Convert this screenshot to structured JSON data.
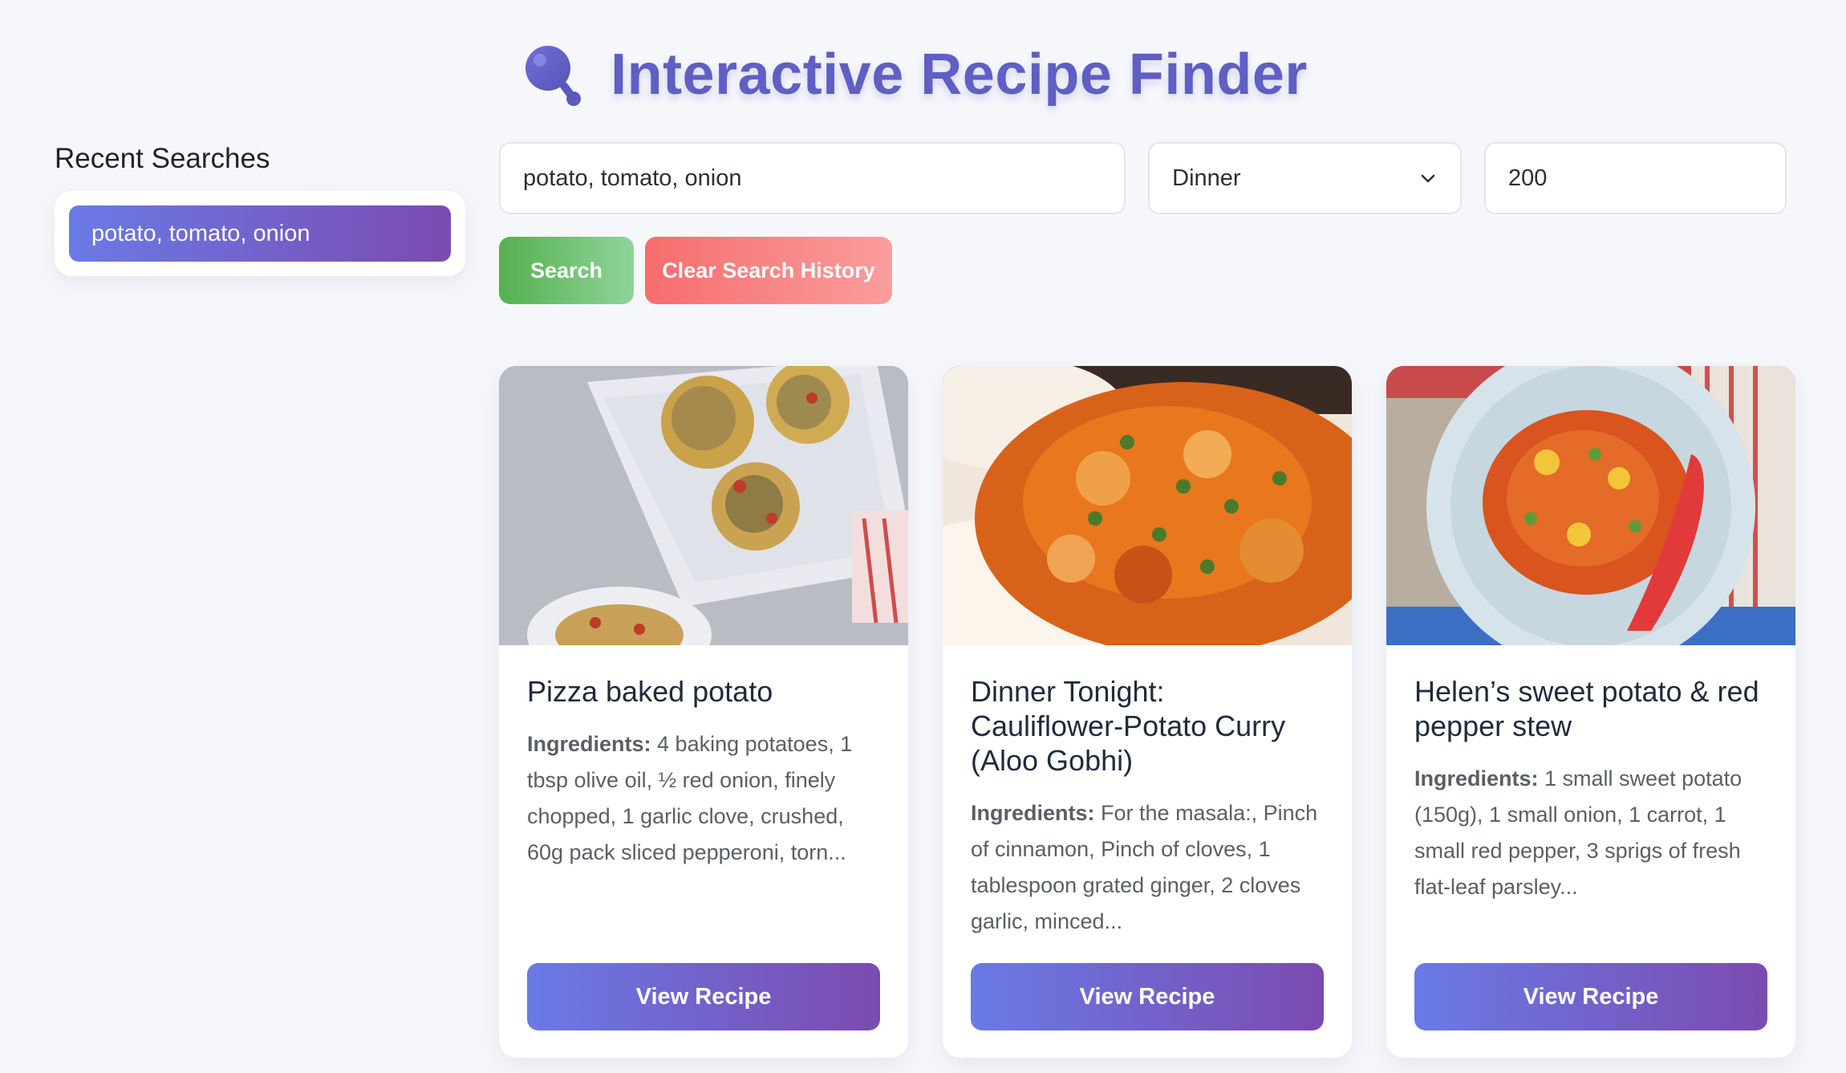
{
  "header": {
    "icon": "magnifier-icon",
    "title": "Interactive Recipe Finder",
    "accent_color": "#5f5fc4"
  },
  "sidebar": {
    "title": "Recent Searches",
    "recent": [
      "potato, tomato, onion"
    ]
  },
  "search": {
    "ingredients_value": "potato, tomato, onion",
    "meal_type_value": "Dinner",
    "calories_value": "200",
    "search_label": "Search",
    "clear_label": "Clear Search History"
  },
  "results": [
    {
      "title": "Pizza baked potato",
      "ingredients_label": "Ingredients:",
      "ingredients": "4 baking potatoes, 1 tbsp olive oil, ½ red onion, finely chopped, 1 garlic clove, crushed, 60g pack sliced pepperoni, torn...",
      "button_label": "View Recipe",
      "image": "potato-skins-dish-photo"
    },
    {
      "title": "Dinner Tonight: Cauliflower-Potato Curry (Aloo Gobhi)",
      "ingredients_label": "Ingredients:",
      "ingredients": "For the masala:, Pinch of cinnamon, Pinch of cloves, 1 tablespoon grated ginger, 2 cloves garlic, minced...",
      "button_label": "View Recipe",
      "image": "aloo-gobhi-curry-photo"
    },
    {
      "title": "Helen’s sweet potato & red pepper stew",
      "ingredients_label": "Ingredients:",
      "ingredients": "1 small sweet potato (150g), 1 small onion, 1 carrot, 1 small red pepper, 3 sprigs of fresh flat-leaf parsley...",
      "button_label": "View Recipe",
      "image": "sweet-potato-stew-photo"
    }
  ]
}
